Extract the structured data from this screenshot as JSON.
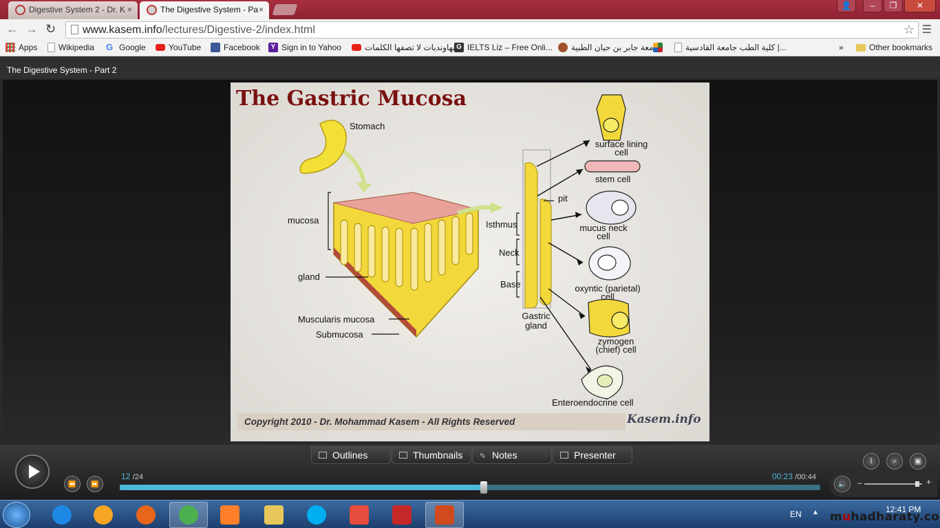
{
  "browser": {
    "tabs": [
      {
        "label": "Digestive System 2 - Dr. K",
        "close": "×"
      },
      {
        "label": "The Digestive System - Pa",
        "close": "×"
      }
    ],
    "window_controls": {
      "minimize": "–",
      "maximize": "❐",
      "close": "✕"
    },
    "nav": {
      "back": "←",
      "forward": "→",
      "reload": "↻"
    },
    "address": {
      "host": "www.kasem.info",
      "path": "/lectures/Digestive-2/index.html"
    },
    "bookmarks": [
      {
        "label": "Apps",
        "icon": "apps-grid-icon",
        "color": "#d44"
      },
      {
        "label": "Wikipedia",
        "icon": "page-icon",
        "color": "#ffffff"
      },
      {
        "label": "Google",
        "icon": "google-icon",
        "color": "#4285f4"
      },
      {
        "label": "YouTube",
        "icon": "youtube-icon",
        "color": "#e62117"
      },
      {
        "label": "Facebook",
        "icon": "facebook-icon",
        "color": "#3b5998"
      },
      {
        "label": "Sign in to Yahoo",
        "icon": "yahoo-icon",
        "color": "#5b1e9c"
      },
      {
        "label": "نهاونديات لا تصفها الكلمات...",
        "icon": "youtube-icon",
        "color": "#e62117"
      },
      {
        "label": "IELTS Liz – Free Onli...",
        "icon": "g-logo-icon",
        "color": "#333333"
      },
      {
        "label": "جامعة جابر بن حيان الطبية",
        "icon": "university-icon",
        "color": "#a0522d"
      },
      {
        "label": "",
        "icon": "site-icon",
        "color": "#2e7d32"
      },
      {
        "label": "كلية الطب جامعة القادسية |...",
        "icon": "page-icon",
        "color": "#ffffff"
      }
    ],
    "bookmarks_more": "»",
    "other_bookmarks": "Other bookmarks"
  },
  "player": {
    "title": "The Digestive System - Part 2",
    "slide": {
      "title": "The Gastric Mucosa",
      "labels": {
        "stomach": "Stomach",
        "mucosa": "mucosa",
        "gland": "gland",
        "muscularis": "Muscularis mucosa",
        "submucosa": "Submucosa",
        "isthmus": "Isthmus",
        "neck": "Neck",
        "base": "Base",
        "pit": "pit",
        "gastric_gland_1": "Gastric",
        "gastric_gland_2": "gland",
        "surface_1": "surface lining",
        "surface_2": "cell",
        "stem": "stem cell",
        "mucus_1": "mucus neck",
        "mucus_2": "cell",
        "oxyntic_1": "oxyntic (parietal)",
        "oxyntic_2": "cell",
        "zymogen_1": "zymogen",
        "zymogen_2": "(chief) cell",
        "entero": "Enteroendocrine cell"
      },
      "copyright": "Copyright 2010 - Dr. Mohammad Kasem - All Rights Reserved",
      "logo": "Kasem.info"
    },
    "tabs": [
      "Outlines",
      "Thumbnails",
      "Notes",
      "Presenter"
    ],
    "current_slide": "12",
    "total_slides": "/24",
    "time_current": "00:23",
    "time_total": "/00:44",
    "seek_progress": 0.52,
    "volume_level": 0.95,
    "volume_minus": "–",
    "volume_plus": "+",
    "prev_label": "⏪",
    "next_label": "⏩"
  },
  "taskbar": {
    "language": "EN",
    "tray_arrow": "▲",
    "time": "12:41 PM",
    "apps": [
      {
        "name": "internet-explorer",
        "color": "#1e88e5",
        "active": false
      },
      {
        "name": "weather",
        "color": "#f6a623",
        "active": false
      },
      {
        "name": "firefox",
        "color": "#e8651c",
        "active": false
      },
      {
        "name": "chrome",
        "color": "#4caf50",
        "active": true
      },
      {
        "name": "media-player",
        "color": "#ff7f2a",
        "active": false
      },
      {
        "name": "file-explorer",
        "color": "#e8c75a",
        "active": false
      },
      {
        "name": "skype",
        "color": "#00aff0",
        "active": false
      },
      {
        "name": "t-app",
        "color": "#e74c3c",
        "active": false
      },
      {
        "name": "acrobat",
        "color": "#c62828",
        "active": false
      },
      {
        "name": "powerpoint",
        "color": "#d04a1e",
        "active": true
      }
    ]
  },
  "watermark": {
    "prefix": "m",
    "accent": "u",
    "rest": "hadharaty.com"
  }
}
